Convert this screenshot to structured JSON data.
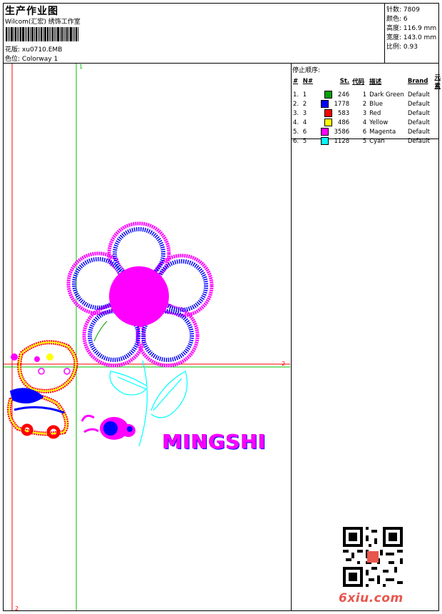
{
  "header": {
    "title": "生产作业图",
    "company": "Wilcom(汇宏) 绣饰工作室",
    "design_label": "花版:",
    "design_value": "xu0710.EMB",
    "colorway_label": "色位:",
    "colorway_value": "Colorway 1"
  },
  "stats": {
    "stitches_label": "针数:",
    "stitches_value": "7809",
    "colors_label": "颜色:",
    "colors_value": "6",
    "height_label": "高度:",
    "height_value": "116.9 mm",
    "width_label": "宽度:",
    "width_value": "143.0 mm",
    "scale_label": "比例:",
    "scale_value": "0.93"
  },
  "stop_sequence": {
    "title": "停止顺序:",
    "headers": [
      "#",
      "N#",
      "St.",
      "代码",
      "描述",
      "Brand",
      "元素"
    ],
    "rows": [
      {
        "idx": "1.",
        "n": "1",
        "color": "#00a000",
        "st": "246",
        "code": "1",
        "desc": "Dark Green",
        "brand": "Default"
      },
      {
        "idx": "2.",
        "n": "2",
        "color": "#0000ff",
        "st": "1778",
        "code": "2",
        "desc": "Blue",
        "brand": "Default"
      },
      {
        "idx": "3.",
        "n": "3",
        "color": "#ff0000",
        "st": "583",
        "code": "3",
        "desc": "Red",
        "brand": "Default"
      },
      {
        "idx": "4.",
        "n": "4",
        "color": "#ffff00",
        "st": "486",
        "code": "4",
        "desc": "Yellow",
        "brand": "Default"
      },
      {
        "idx": "5.",
        "n": "6",
        "color": "#ff00ff",
        "st": "3586",
        "code": "6",
        "desc": "Magenta",
        "brand": "Default"
      },
      {
        "idx": "6.",
        "n": "5",
        "color": "#00ffff",
        "st": "1128",
        "code": "5",
        "desc": "Cyan",
        "brand": "Default"
      }
    ]
  },
  "canvas": {
    "design_text": "MINGSHI",
    "axis_label_top": "1",
    "axis_label_right": "2",
    "axis_label_bottom": "2"
  },
  "colors": {
    "magenta": "#ff00ff",
    "blue": "#0000ff",
    "cyan": "#00ffff",
    "red": "#ff0000",
    "yellow": "#ffff00",
    "green": "#00c000"
  },
  "watermark": {
    "site": "6xiu.com"
  }
}
